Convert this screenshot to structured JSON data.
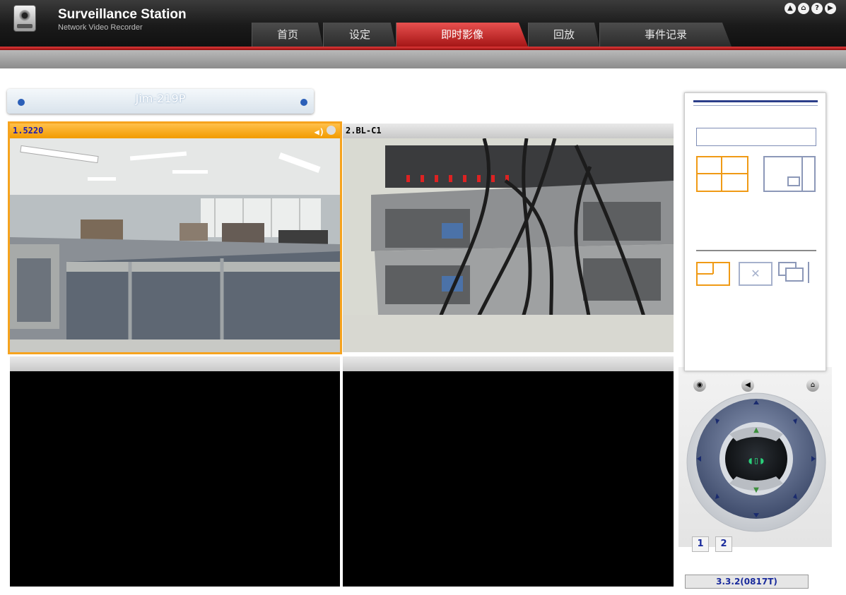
{
  "app": {
    "title": "Surveillance Station",
    "subtitle": "Network Video Recorder"
  },
  "tabs": [
    {
      "label": "首页"
    },
    {
      "label": "设定"
    },
    {
      "label": "即时影像"
    },
    {
      "label": "回放"
    },
    {
      "label": "事件记录"
    }
  ],
  "active_tab": "即时影像",
  "host": {
    "name": "Jim-219P"
  },
  "cameras": [
    {
      "label": "1.5220",
      "status": "active"
    },
    {
      "label": "2.BL-C1",
      "status": "normal"
    },
    {
      "label": "",
      "status": "empty"
    },
    {
      "label": "",
      "status": "empty"
    }
  ],
  "pages": [
    "1",
    "2"
  ],
  "version": "3.3.2(0817T)",
  "colors": {
    "accent_red": "#c8202a",
    "active_orange": "#f6a31e",
    "panel_blue": "#1a2b9c"
  },
  "icons": {
    "top": [
      "up-icon",
      "home-icon",
      "help-icon",
      "logout-icon"
    ],
    "ptz_top": [
      "snapshot-icon",
      "audio-icon",
      "ptz-home-icon"
    ]
  }
}
